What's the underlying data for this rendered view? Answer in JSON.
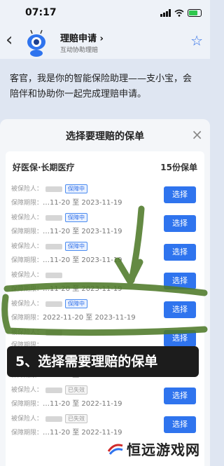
{
  "status": {
    "time": "07:17"
  },
  "header": {
    "back": "‹",
    "title": "理赔申请 ›",
    "subtitle": "互动协助理赔",
    "star": "☆"
  },
  "intro": {
    "message": "客官，我是你的智能保险助理——支小宝，会陪伴和协助你一起完成理赔申请。"
  },
  "sheet": {
    "title": "选择要理赔的保单",
    "close": "×"
  },
  "policy": {
    "name": "好医保·长期医疗",
    "count": "15份保单"
  },
  "labels": {
    "insured": "被保险人：",
    "period": "保障期限：",
    "select": "选择"
  },
  "rows": [
    {
      "status": "保障中",
      "period": "…11-20 至 2023-11-19",
      "lapsed": false
    },
    {
      "status": "保障中",
      "period": "…11-20 至 2023-11-19",
      "lapsed": false
    },
    {
      "status": "保障中",
      "period": "…11-20 至 2023-11-19",
      "lapsed": false
    },
    {
      "status": "",
      "period": "…11-20 至 2023-11-19",
      "lapsed": false
    },
    {
      "status": "保障中",
      "period": "2022-11-20 至 2023-11-19",
      "lapsed": false
    },
    {
      "status": "",
      "period": "",
      "lapsed": false
    },
    {
      "status": "",
      "period": "…11-20 至 2022-11-19",
      "lapsed": false
    },
    {
      "status": "已失效",
      "period": "…11-20 至 2022-11-19",
      "lapsed": true
    },
    {
      "status": "已失效",
      "period": "…11-20 至 2022-11-19",
      "lapsed": true
    }
  ],
  "caption": "5、选择需要理赔的保单",
  "watermark": {
    "text": "恒远游戏网"
  },
  "colors": {
    "accent": "#2f74ee",
    "scribble": "#4f7a2a",
    "caption_bg": "#1c1c1c"
  },
  "icons": [
    "back-arrow-icon",
    "robot-avatar-icon",
    "star-icon",
    "close-icon",
    "wifi-icon",
    "signal-icon",
    "battery-icon"
  ]
}
